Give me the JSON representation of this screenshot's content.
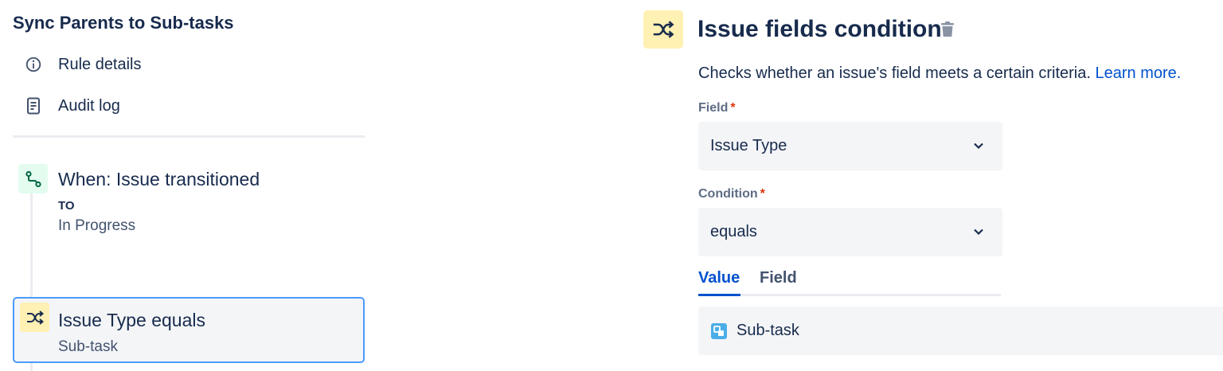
{
  "sidebar": {
    "rule_title": "Sync Parents to Sub-tasks",
    "items": [
      {
        "label": "Rule details",
        "icon": "info-icon"
      },
      {
        "label": "Audit log",
        "icon": "document-icon"
      }
    ]
  },
  "flow": {
    "trigger": {
      "title": "When: Issue transitioned",
      "sub_label": "TO",
      "value": "In Progress",
      "icon": "branch-icon",
      "icon_color": "#E3FCEF"
    },
    "condition": {
      "title": "Issue Type equals",
      "value": "Sub-task",
      "icon": "shuffle-icon",
      "icon_color": "#FFF0B3",
      "selected_border": "#4C9AFF"
    }
  },
  "editor": {
    "title": "Issue fields condition",
    "description": "Checks whether an issue's field meets a certain criteria.",
    "learn_more": "Learn more.",
    "field_label": "Field",
    "field_value": "Issue Type",
    "condition_label": "Condition",
    "condition_value": "equals",
    "required_marker": "*",
    "tabs": [
      {
        "label": "Value",
        "active": true
      },
      {
        "label": "Field",
        "active": false
      }
    ],
    "value_selected": "Sub-task",
    "accent": "#0052CC",
    "required_color": "#DE350B"
  }
}
